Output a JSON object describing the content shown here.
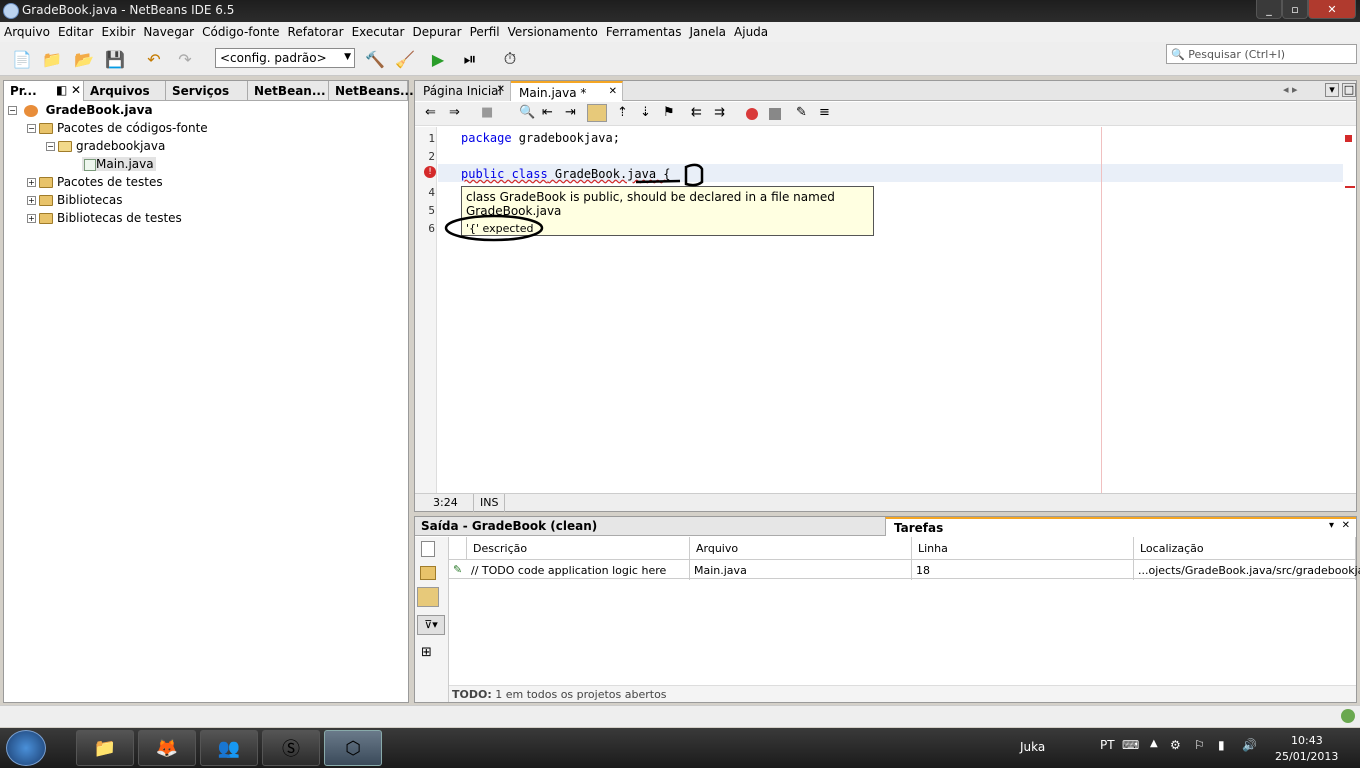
{
  "window": {
    "title": "GradeBook.java - NetBeans IDE 6.5"
  },
  "menu": [
    "Arquivo",
    "Editar",
    "Exibir",
    "Navegar",
    "Código-fonte",
    "Refatorar",
    "Executar",
    "Depurar",
    "Perfil",
    "Versionamento",
    "Ferramentas",
    "Janela",
    "Ajuda"
  ],
  "toolbar": {
    "config_value": "<config. padrão>",
    "search_placeholder": "Pesquisar (Ctrl+I)"
  },
  "left_panel": {
    "tabs": [
      "Pr...",
      "Arquivos",
      "Serviços",
      "NetBean...",
      "NetBeans..."
    ],
    "tree": {
      "root": "GradeBook.java",
      "src": "Pacotes de códigos-fonte",
      "package": "gradebookjava",
      "file": "Main.java",
      "tests": "Pacotes de testes",
      "libs": "Bibliotecas",
      "test_libs": "Bibliotecas de testes"
    }
  },
  "editor": {
    "tabs": [
      "Página Inicial",
      "Main.java *"
    ],
    "lines": [
      "1",
      "2",
      "3",
      "4",
      "5",
      "6"
    ],
    "code": {
      "line1_kw": "package",
      "line1_rest": " gradebookjava;",
      "line3_kw": "public class",
      "line3_rest": " GradeBook.java {"
    },
    "tooltip": {
      "line1": "class GradeBook is public, should be declared in a file named GradeBook.java",
      "line2": "'{' expected"
    },
    "status": {
      "position": "3:24",
      "mode": "INS"
    }
  },
  "output": {
    "tab1": "Saída - GradeBook (clean)",
    "tab2": "Tarefas",
    "columns": [
      "Descrição",
      "Arquivo",
      "Linha",
      "Localização"
    ],
    "row": {
      "desc": "// TODO code application logic here",
      "file": "Main.java",
      "line": "18",
      "location": "...ojects/GradeBook.java/src/gradebookjava"
    },
    "footer_bold": "TODO:",
    "footer_rest": " 1 em todos os projetos abertos"
  },
  "taskbar": {
    "user": "Juka",
    "lang": "PT",
    "time": "10:43",
    "date": "25/01/2013"
  }
}
